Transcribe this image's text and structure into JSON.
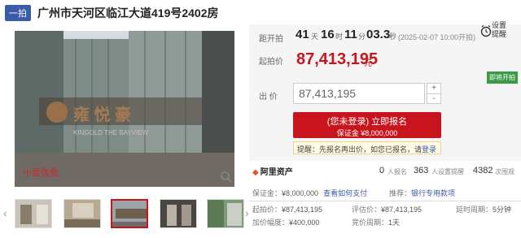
{
  "header": {
    "badge": "一拍",
    "title": "广州市天河区临江大道419号2402房"
  },
  "gallery": {
    "watermark": "小雷兔兔"
  },
  "countdown": {
    "label": "距开拍",
    "days": "41",
    "days_unit": "天",
    "hours": "16",
    "hours_unit": "时",
    "minutes": "11",
    "minutes_unit": "分",
    "seconds": "03.3",
    "seconds_unit": "秒",
    "start_time": "(2025-02-07 10:00开拍)"
  },
  "reminder": {
    "label": "设置提醒",
    "icon": "alarm-clock-icon"
  },
  "start_price": {
    "label": "起拍价",
    "value": "87,413,195",
    "unit": "元"
  },
  "status_tag": "即将开拍",
  "bid": {
    "label": "出 价",
    "value": "87,413,195",
    "plus": "+",
    "minus": "-"
  },
  "apply": {
    "line1": "(您未登录) 立即报名",
    "line2": "保证金 ¥8,000,000"
  },
  "tip": {
    "prefix": "提醒：先报名再出价，如您已报名，请",
    "link": "登录"
  },
  "stats": {
    "logo": "阿里资产",
    "applicants": "0",
    "applicants_label": "人报名",
    "reminders": "363",
    "reminders_label": "人设置提醒",
    "views": "4382",
    "views_label": "次围观"
  },
  "details": {
    "deposit_k": "保证金：",
    "deposit_v": "¥8,000,000",
    "deposit_link": "查看如何支付",
    "recommend_k": "推荐：",
    "recommend_v": "银行专用款项",
    "start_k": "起拍价：",
    "start_v": "¥87,413,195",
    "appraise_k": "评估价：",
    "appraise_v": "¥87,413,195",
    "delay_k": "延时周期：",
    "delay_v": "5分钟",
    "increment_k": "加价幅度：",
    "increment_v": "¥400,000",
    "notice_k": "竞价周期：",
    "notice_v": "1天"
  },
  "colors": {
    "accent": "#c8151d",
    "brand": "#3b5aa8",
    "status": "#3a9b47"
  }
}
